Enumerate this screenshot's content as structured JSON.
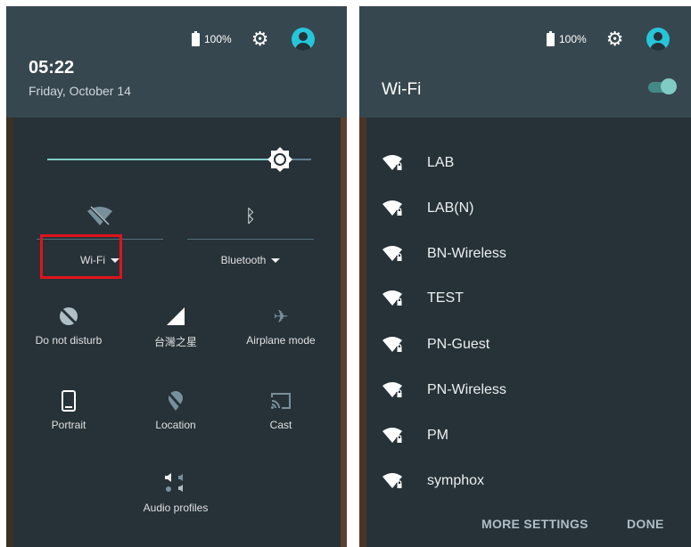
{
  "colors": {
    "panel_bg": "#263238",
    "header_bg": "#37474f",
    "accent": "#26c6da",
    "toggle": "#80cbc4",
    "highlight": "#e0131a"
  },
  "left": {
    "status": {
      "battery": "100%",
      "battery_icon": "battery-icon",
      "settings_icon": "gear-icon",
      "user_icon": "user-avatar-icon"
    },
    "time": "05:22",
    "date": "Friday, October 14",
    "brightness": {
      "level": 0.92
    },
    "tiles": [
      {
        "label": "Wi-Fi",
        "icon": "wifi-off-icon",
        "has_dropdown": true
      },
      {
        "label": "Bluetooth",
        "icon": "bluetooth-icon",
        "has_dropdown": true
      },
      {
        "label": "Do not disturb",
        "icon": "do-not-disturb-icon"
      },
      {
        "label": "台灣之星",
        "icon": "cellular-signal-icon"
      },
      {
        "label": "Airplane mode",
        "icon": "airplane-icon"
      },
      {
        "label": "Portrait",
        "icon": "portrait-icon"
      },
      {
        "label": "Location",
        "icon": "location-off-icon"
      },
      {
        "label": "Cast",
        "icon": "cast-icon"
      },
      {
        "label": "Audio profiles",
        "icon": "audio-profiles-icon"
      }
    ]
  },
  "right": {
    "status": {
      "battery": "100%",
      "battery_icon": "battery-icon",
      "settings_icon": "gear-icon",
      "user_icon": "user-avatar-icon"
    },
    "title": "Wi-Fi",
    "toggle_on": true,
    "networks": [
      {
        "ssid": "LAB"
      },
      {
        "ssid": "LAB(N)"
      },
      {
        "ssid": "BN-Wireless"
      },
      {
        "ssid": "TEST"
      },
      {
        "ssid": "PN-Guest"
      },
      {
        "ssid": "PN-Wireless"
      },
      {
        "ssid": "PM"
      },
      {
        "ssid": "symphox"
      }
    ],
    "buttons": {
      "more_settings": "MORE SETTINGS",
      "done": "DONE"
    }
  }
}
